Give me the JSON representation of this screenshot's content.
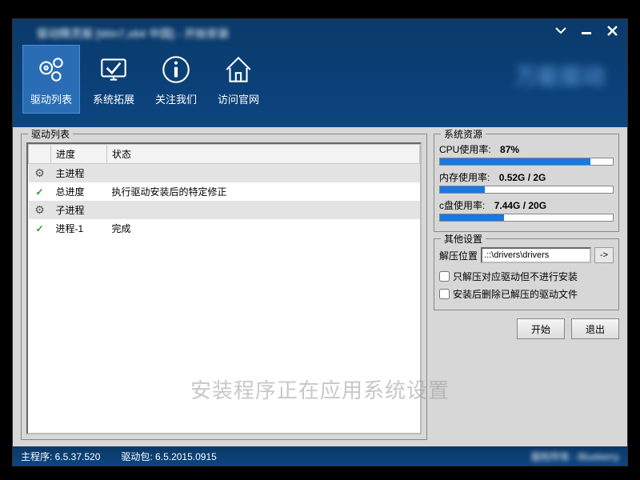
{
  "title": "驱动精灵版 [Win7,x64 中国] - 开始安装",
  "brand": "万能驱动",
  "toolbar": [
    {
      "label": "驱动列表",
      "name": "drivers-tab"
    },
    {
      "label": "系统拓展",
      "name": "system-ext-tab"
    },
    {
      "label": "关注我们",
      "name": "follow-us-tab"
    },
    {
      "label": "访问官网",
      "name": "website-tab"
    }
  ],
  "driver_list": {
    "legend": "驱动列表",
    "cols": {
      "c0": "",
      "c1": "进度",
      "c2": "状态"
    },
    "rows": [
      {
        "type": "group",
        "icon": "gear",
        "label": "主进程",
        "status": ""
      },
      {
        "type": "item",
        "icon": "check",
        "label": "总进度",
        "status": "执行驱动安装后的特定修正"
      },
      {
        "type": "group",
        "icon": "gear",
        "label": "子进程",
        "status": ""
      },
      {
        "type": "item",
        "icon": "check",
        "label": "进程-1",
        "status": "完成"
      }
    ]
  },
  "resources": {
    "legend": "系统资源",
    "cpu": {
      "label": "CPU使用率:",
      "value": "87%",
      "pct": 87
    },
    "mem": {
      "label": "内存使用率:",
      "value": "0.52G / 2G",
      "pct": 26
    },
    "disk": {
      "label": "c盘使用率:",
      "value": "7.44G / 20G",
      "pct": 37
    }
  },
  "settings": {
    "legend": "其他设置",
    "extract_label": "解压位置",
    "extract_path": ".::\\drivers\\drivers",
    "browse": "->",
    "opt1": "只解压对应驱动但不进行安装",
    "opt2": "安装后删除已解压的驱动文件"
  },
  "buttons": {
    "start": "开始",
    "exit": "退出"
  },
  "status": {
    "main": "主程序: 6.5.37.520",
    "pack": "驱动包: 6.5.2015.0915",
    "right": "版权所有 - Blueberry"
  },
  "overlay": "安装程序正在应用系统设置"
}
